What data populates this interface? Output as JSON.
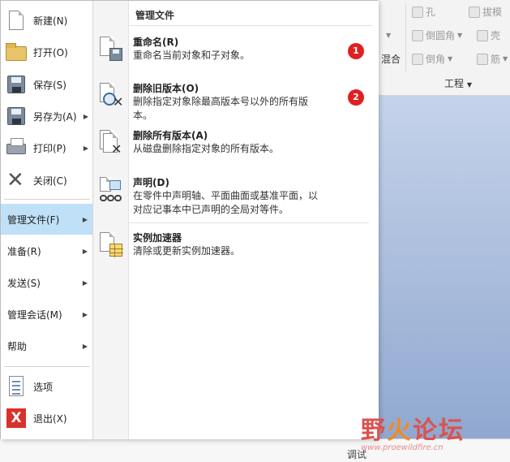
{
  "ribbon": {
    "items": [
      {
        "label": "孔",
        "icon": "hole-icon"
      },
      {
        "label": "拔模",
        "icon": "draft-icon"
      },
      {
        "label": "倒圆角",
        "icon": "round-icon"
      },
      {
        "label": "壳",
        "icon": "shell-icon"
      },
      {
        "label": "倒角",
        "icon": "chamfer-icon"
      },
      {
        "label": "筋",
        "icon": "rib-icon"
      }
    ],
    "partial_label": "混合",
    "group_label": "工程"
  },
  "file_menu": {
    "commands": [
      {
        "label": "新建(N)",
        "icon": "new-file-icon"
      },
      {
        "label": "打开(O)",
        "icon": "open-folder-icon"
      },
      {
        "label": "保存(S)",
        "icon": "save-disk-icon"
      },
      {
        "label": "另存为(A)",
        "icon": "save-as-icon",
        "has_submenu": true
      },
      {
        "label": "打印(P)",
        "icon": "printer-icon",
        "has_submenu": true
      },
      {
        "label": "关闭(C)",
        "icon": "close-icon"
      }
    ],
    "submenus": [
      {
        "label": "管理文件(F)",
        "active": true
      },
      {
        "label": "准备(R)"
      },
      {
        "label": "发送(S)"
      },
      {
        "label": "管理会话(M)"
      },
      {
        "label": "帮助"
      }
    ],
    "bottom_commands": [
      {
        "label": "选项",
        "icon": "options-list-icon"
      },
      {
        "label": "退出(X)",
        "icon": "exit-icon"
      }
    ]
  },
  "manage_panel": {
    "title": "管理文件",
    "entries": [
      {
        "title": "重命名(R)",
        "desc": "重命名当前对象和子对象。",
        "icon": "rename-icon",
        "badge": "1"
      },
      {
        "title": "删除旧版本(O)",
        "desc": "删除指定对象除最高版本号以外的所有版本。",
        "icon": "delete-old-versions-icon",
        "badge": "2"
      },
      {
        "title": "删除所有版本(A)",
        "desc": "从磁盘删除指定对象的所有版本。",
        "icon": "delete-all-versions-icon"
      },
      {
        "title": "声明(D)",
        "desc": "在零件中声明轴、平面曲面或基准平面，以对应记事本中已声明的全局对等件。",
        "icon": "declare-icon"
      },
      {
        "title": "实例加速器",
        "desc": "清除或更新实例加速器。",
        "icon": "instance-accelerator-icon"
      }
    ]
  },
  "status": {
    "tune_label": "调试"
  },
  "watermark": {
    "text_main": "野",
    "text_fire": "火",
    "text_rest": "论坛",
    "url": "www.proewildfire.cn"
  }
}
